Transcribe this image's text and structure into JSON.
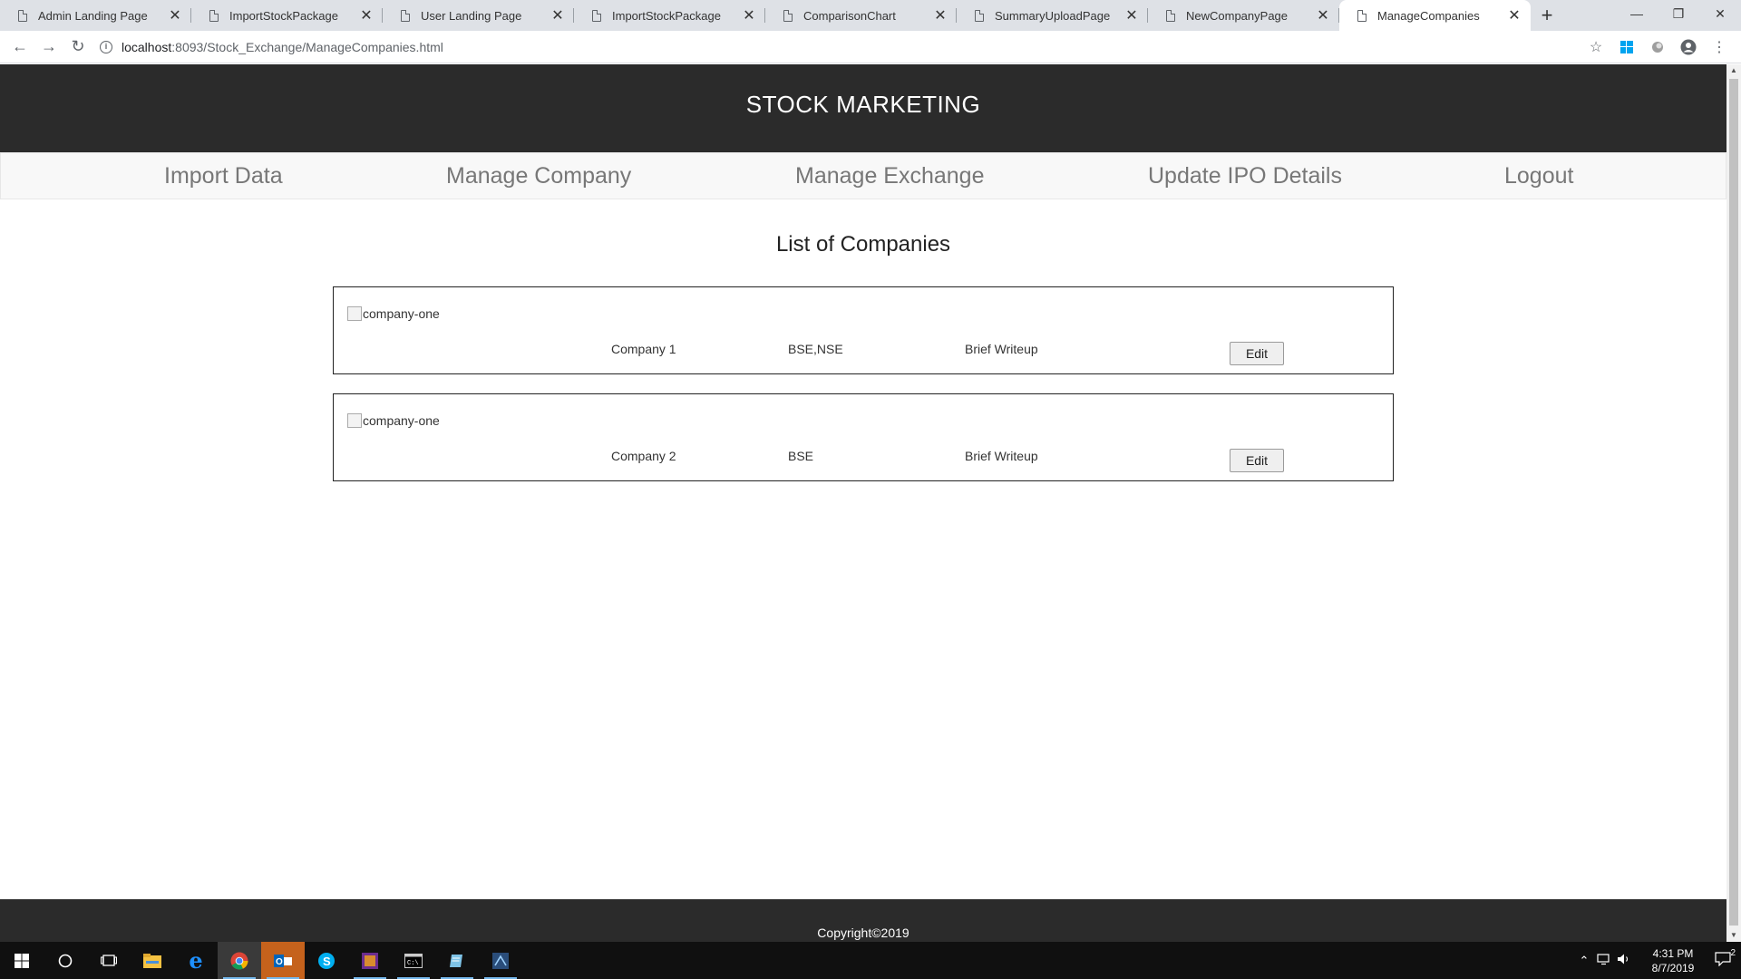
{
  "browser": {
    "tabs": [
      {
        "title": "Admin Landing Page"
      },
      {
        "title": "ImportStockPackage"
      },
      {
        "title": "User Landing Page"
      },
      {
        "title": "ImportStockPackage"
      },
      {
        "title": "ComparisonChart"
      },
      {
        "title": "SummaryUploadPage"
      },
      {
        "title": "NewCompanyPage"
      },
      {
        "title": "ManageCompanies"
      }
    ],
    "active_tab_index": 7,
    "url_host": "localhost",
    "url_path": ":8093/Stock_Exchange/ManageCompanies.html"
  },
  "site": {
    "title": "STOCK MARKETING",
    "nav": [
      {
        "label": "Import Data"
      },
      {
        "label": "Manage Company"
      },
      {
        "label": "Manage Exchange"
      },
      {
        "label": "Update IPO Details"
      },
      {
        "label": "Logout"
      }
    ],
    "list_heading": "List of Companies",
    "companies": [
      {
        "logo_alt": "company-one",
        "name": "Company 1",
        "exchanges": "BSE,NSE",
        "writeup": "Brief Writeup",
        "edit_label": "Edit"
      },
      {
        "logo_alt": "company-one",
        "name": "Company 2",
        "exchanges": "BSE",
        "writeup": "Brief Writeup",
        "edit_label": "Edit"
      }
    ],
    "footer": "Copyright©2019"
  },
  "taskbar": {
    "time": "4:31 PM",
    "date": "8/7/2019",
    "notifications": "2"
  },
  "colors": {
    "header_bg": "#2b2b2b",
    "nav_bg": "#f8f8f8",
    "nav_text": "#777777"
  }
}
